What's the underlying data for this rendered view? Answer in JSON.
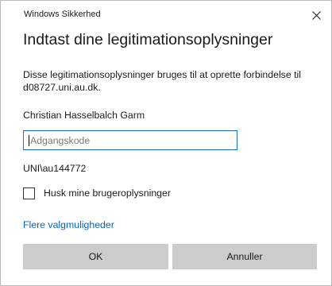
{
  "window": {
    "title": "Windows Sikkerhed",
    "close_icon": "close-icon"
  },
  "dialog": {
    "heading": "Indtast dine legitimationsoplysninger",
    "description": "Disse legitimationsoplysninger bruges til at oprette forbindelse til d08727.uni.au.dk.",
    "username": "Christian Hasselbalch Garm",
    "password": {
      "value": "",
      "placeholder": "Adgangskode"
    },
    "domain_user": "UNI\\au144772",
    "remember": {
      "label": "Husk mine brugeroplysninger",
      "checked": false
    },
    "more_options": "Flere valgmuligheder",
    "ok_label": "OK",
    "cancel_label": "Annuller"
  },
  "colors": {
    "link": "#0066cc",
    "input_border": "#1a6fc7",
    "button_bg": "#cccccc"
  }
}
